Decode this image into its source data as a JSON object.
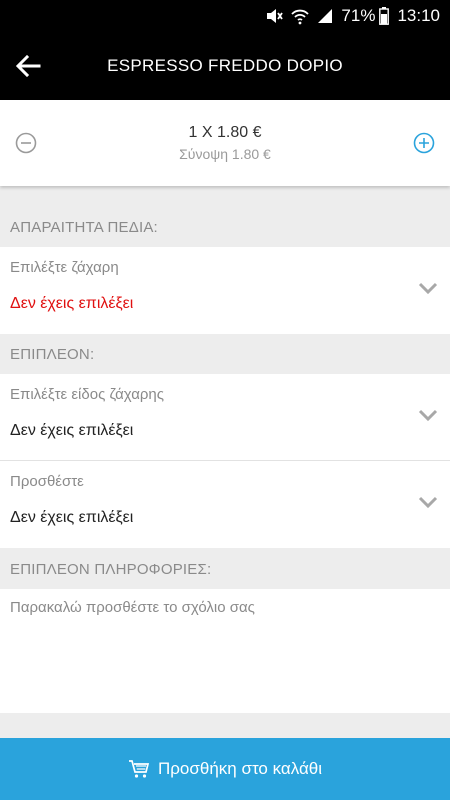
{
  "status_bar": {
    "battery": "71%",
    "time": "13:10"
  },
  "header": {
    "title": "ESPRESSO FREDDO DOPIO"
  },
  "quantity": {
    "line": "1 X 1.80 €",
    "summary": "Σύνοψη 1.80 €"
  },
  "sections": {
    "required": {
      "header": "ΑΠΑΡΑΙΤΗΤΑ ΠΕΔΙΑ:"
    },
    "extra": {
      "header": "ΕΠΙΠΛΕΟΝ:"
    },
    "info": {
      "header": "ΕΠΙΠΛΕΟΝ ΠΛΗΡΟΦΟΡΙΕΣ:"
    }
  },
  "fields": {
    "sugar": {
      "label": "Επιλέξτε ζάχαρη",
      "value": "Δεν έχεις επιλέξει"
    },
    "sugar_type": {
      "label": "Επιλέξτε είδος ζάχαρης",
      "value": "Δεν έχεις επιλέξει"
    },
    "add": {
      "label": "Προσθέστε",
      "value": "Δεν έχεις επιλέξει"
    }
  },
  "comment": {
    "placeholder": "Παρακαλώ προσθέστε το σχόλιο σας",
    "value": ""
  },
  "cart_button": {
    "label": "Προσθήκη στο καλάθι"
  },
  "colors": {
    "header_bg": "#000000",
    "accent": "#2aa3dc",
    "error": "#e01010",
    "muted": "#8a8a8a"
  }
}
